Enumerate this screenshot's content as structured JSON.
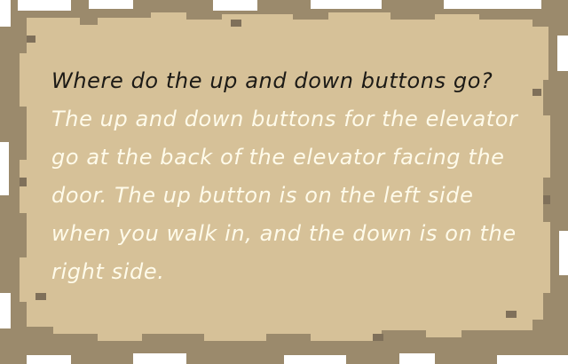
{
  "dialog": {
    "question": "Where do the up and down buttons go?",
    "answer": "The up and down buttons for the elevator go at the back of the elevator facing the door. The up button is on the left side when you walk in, and the down is on the right side."
  },
  "colors": {
    "parchment": "#d6c198",
    "border": "#9b8a6c",
    "question_text": "#1c1a16",
    "answer_text": "#fffbea"
  }
}
